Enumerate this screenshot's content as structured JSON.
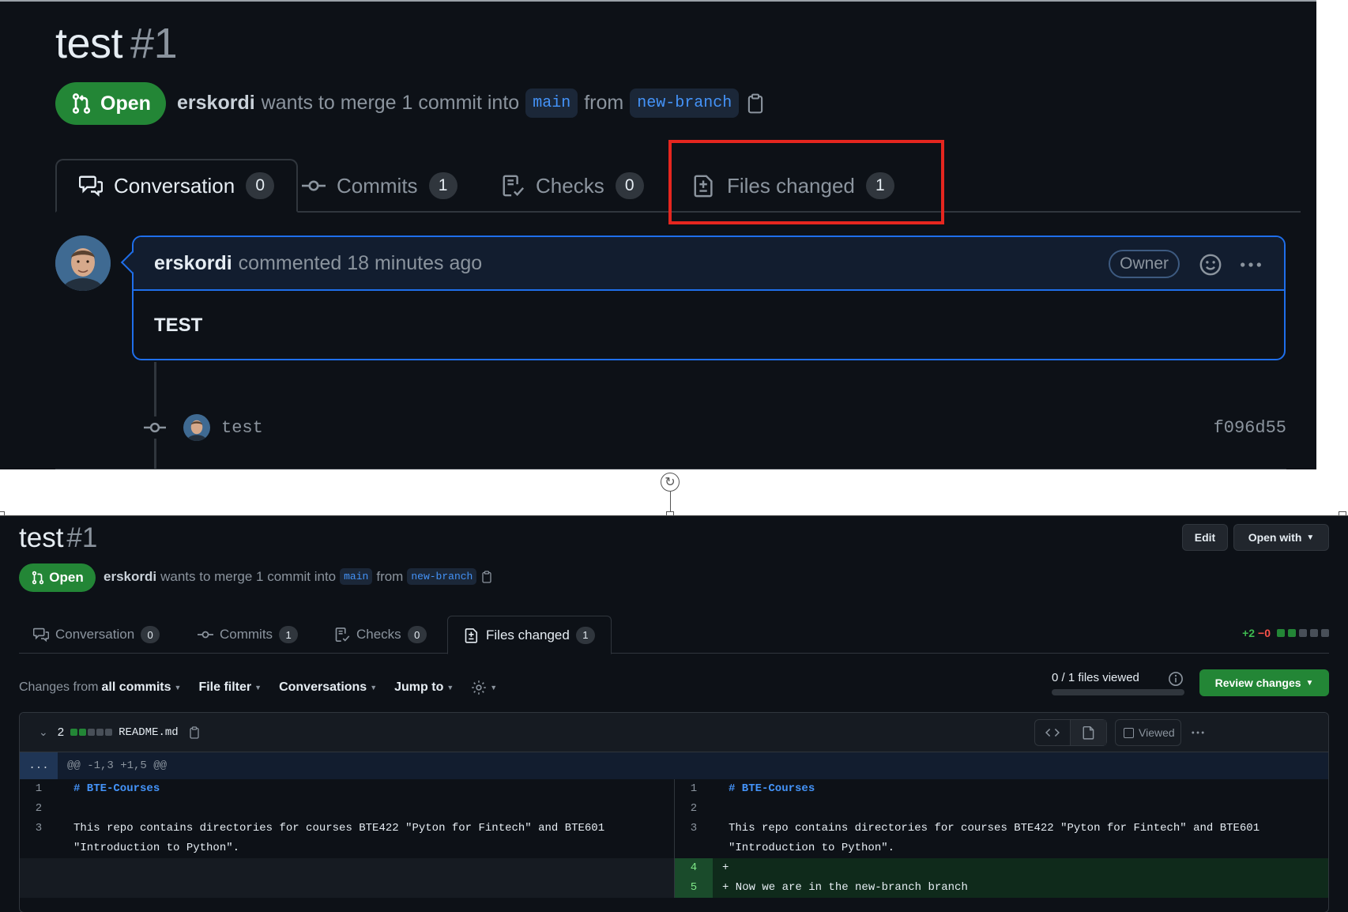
{
  "pr": {
    "title": "test",
    "number": "#1",
    "state": "Open",
    "author": "erskordi",
    "merge_text": "wants to merge 1 commit into",
    "base_branch": "main",
    "from_text": "from",
    "head_branch": "new-branch"
  },
  "tabs": [
    {
      "label": "Conversation",
      "count": "0"
    },
    {
      "label": "Commits",
      "count": "1"
    },
    {
      "label": "Checks",
      "count": "0"
    },
    {
      "label": "Files changed",
      "count": "1"
    }
  ],
  "comment": {
    "author": "erskordi",
    "action": "commented 18 minutes ago",
    "role": "Owner",
    "body": "TEST"
  },
  "commit": {
    "message": "test",
    "sha": "f096d55"
  },
  "header_buttons": {
    "edit": "Edit",
    "open_with": "Open with"
  },
  "diffstat": {
    "added": "+2",
    "removed": "−0"
  },
  "toolbar": {
    "changes_prefix": "Changes from",
    "changes_value": "all commits",
    "file_filter": "File filter",
    "conversations": "Conversations",
    "jump_to": "Jump to",
    "files_viewed": "0 / 1 files viewed",
    "files_viewed_progress": 0,
    "review_changes": "Review changes"
  },
  "file": {
    "changes": "2",
    "name": "README.md",
    "viewed_label": "Viewed",
    "hunk_expander": "...",
    "hunk_header": "@@ -1,3 +1,5 @@",
    "left_lines": [
      {
        "num": "1",
        "text": "# BTE-Courses"
      },
      {
        "num": "2",
        "text": ""
      },
      {
        "num": "3",
        "text": "This repo contains directories for courses BTE422 \"Pyton for Fintech\" and BTE601 \"Introduction to Python\"."
      }
    ],
    "right_lines": [
      {
        "num": "1",
        "text": "# BTE-Courses"
      },
      {
        "num": "2",
        "text": ""
      },
      {
        "num": "3",
        "text": "This repo contains directories for courses BTE422 \"Pyton for Fintech\" and BTE601 \"Introduction to Python\"."
      },
      {
        "num": "4",
        "text": "+"
      },
      {
        "num": "5",
        "text": "+ Now we are in the new-branch branch"
      }
    ]
  },
  "colors": {
    "open_green": "#238636",
    "link_blue": "#4493f8",
    "highlight_red": "#e5261f",
    "addition_bg": "#0f2a1b"
  }
}
